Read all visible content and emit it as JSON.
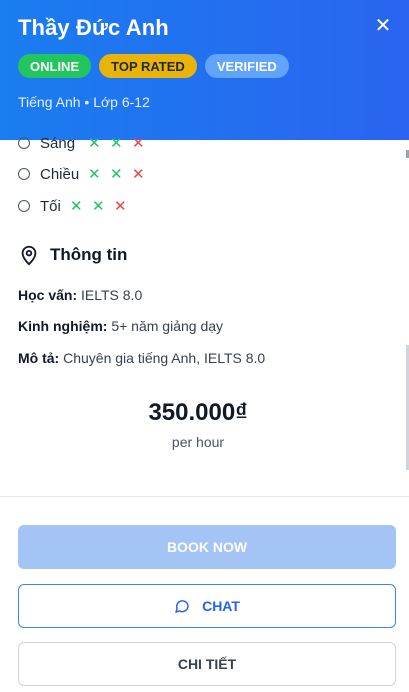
{
  "header": {
    "title": "Thầy Đức Anh",
    "close_icon": "close-icon",
    "badges": [
      "ONLINE",
      "TOP RATED",
      "VERIFIED"
    ],
    "subtitle": "Tiếng Anh • Lớp 6-12"
  },
  "schedule": {
    "rows": [
      {
        "label": "Sáng",
        "marks": [
          "✕",
          "✕",
          "✕"
        ],
        "status": [
          "available",
          "available",
          "unavailable"
        ]
      },
      {
        "label": "Chiều",
        "marks": [
          "✕",
          "✕",
          "✕"
        ],
        "status": [
          "available",
          "available",
          "unavailable"
        ]
      },
      {
        "label": "Tối",
        "marks": [
          "✕",
          "✕",
          "✕"
        ],
        "status": [
          "available",
          "available",
          "unavailable"
        ]
      }
    ],
    "colors": {
      "available": "#22c55e",
      "unavailable": "#ef4444"
    }
  },
  "info": {
    "title": "Thông tin",
    "icon": "map-pin-icon",
    "education_label": "Học vấn:",
    "education_value": "IELTS 8.0",
    "experience_label": "Kinh nghiệm:",
    "experience_value": "5+ năm giảng dạy",
    "description_label": "Mô tả:",
    "description_value": "Chuyên gia tiếng Anh, IELTS 8.0"
  },
  "pricing": {
    "price": "350.000₫",
    "unit": "per hour"
  },
  "actions": {
    "book_label": "BOOK NOW",
    "chat_label": "CHAT",
    "chat_icon": "chat-bubble-icon",
    "detail_label": "CHI TIẾT"
  },
  "theme": {
    "header_gradient_start": "#1a7df0",
    "header_gradient_end": "#2a64f0",
    "primary": "#2563eb"
  }
}
